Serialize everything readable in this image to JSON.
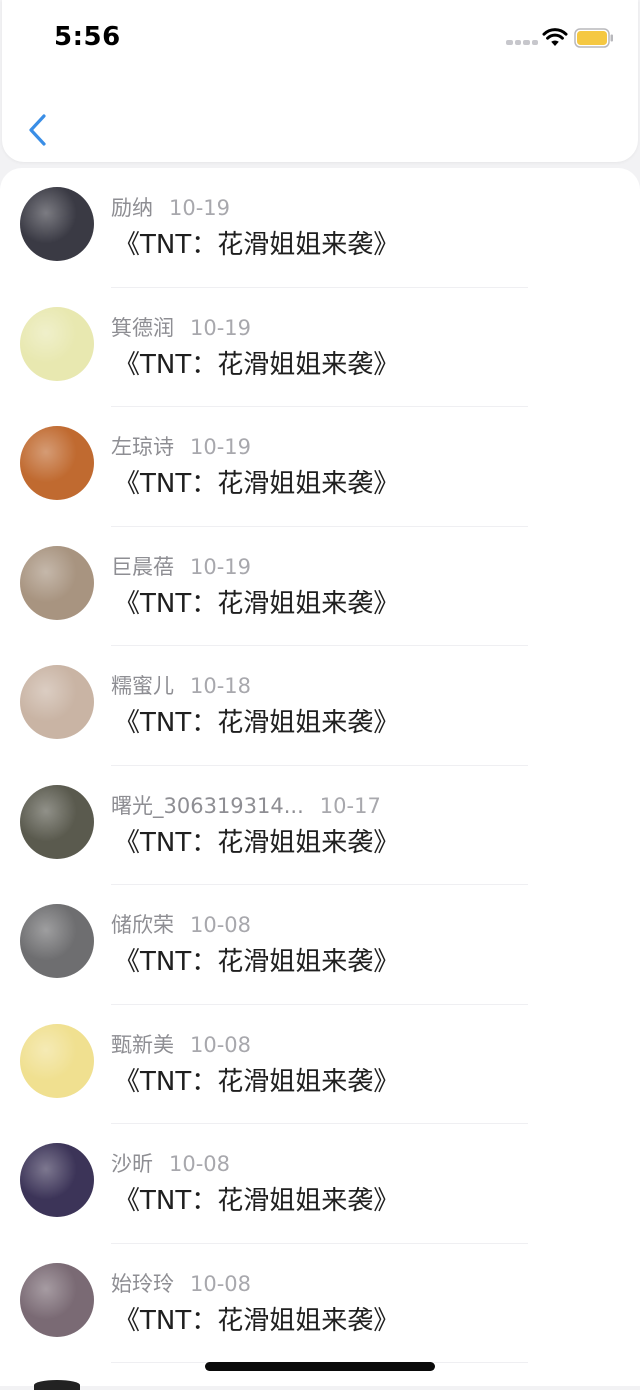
{
  "status": {
    "time": "5:56",
    "signal_icon": "signal-dots-icon",
    "wifi_icon": "wifi-icon",
    "battery_icon": "battery-icon",
    "battery_color": "#f5c842"
  },
  "nav": {
    "back_icon": "chevron-left-icon",
    "accent": "#3a8ee6"
  },
  "items": [
    {
      "name": "励纳",
      "date": "10-19",
      "title": "《TNT：花滑姐姐来袭》",
      "avatar_color": "#3a3a44"
    },
    {
      "name": "箕德润",
      "date": "10-19",
      "title": "《TNT：花滑姐姐来袭》",
      "avatar_color": "#e8e8b0"
    },
    {
      "name": "左琼诗",
      "date": "10-19",
      "title": "《TNT：花滑姐姐来袭》",
      "avatar_color": "#c06a30"
    },
    {
      "name": "巨晨蓓",
      "date": "10-19",
      "title": "《TNT：花滑姐姐来袭》",
      "avatar_color": "#a89480"
    },
    {
      "name": "糯蜜儿",
      "date": "10-18",
      "title": "《TNT：花滑姐姐来袭》",
      "avatar_color": "#c9b4a4"
    },
    {
      "name": "曙光_306319314...",
      "date": "10-17",
      "title": "《TNT：花滑姐姐来袭》",
      "avatar_color": "#5a5a4e"
    },
    {
      "name": "储欣荣",
      "date": "10-08",
      "title": "《TNT：花滑姐姐来袭》",
      "avatar_color": "#6e6e70"
    },
    {
      "name": "甄新美",
      "date": "10-08",
      "title": "《TNT：花滑姐姐来袭》",
      "avatar_color": "#f0e090"
    },
    {
      "name": "沙昕",
      "date": "10-08",
      "title": "《TNT：花滑姐姐来袭》",
      "avatar_color": "#3c3458"
    },
    {
      "name": "始玲玲",
      "date": "10-08",
      "title": "《TNT：花滑姐姐来袭》",
      "avatar_color": "#7a6a74"
    }
  ]
}
